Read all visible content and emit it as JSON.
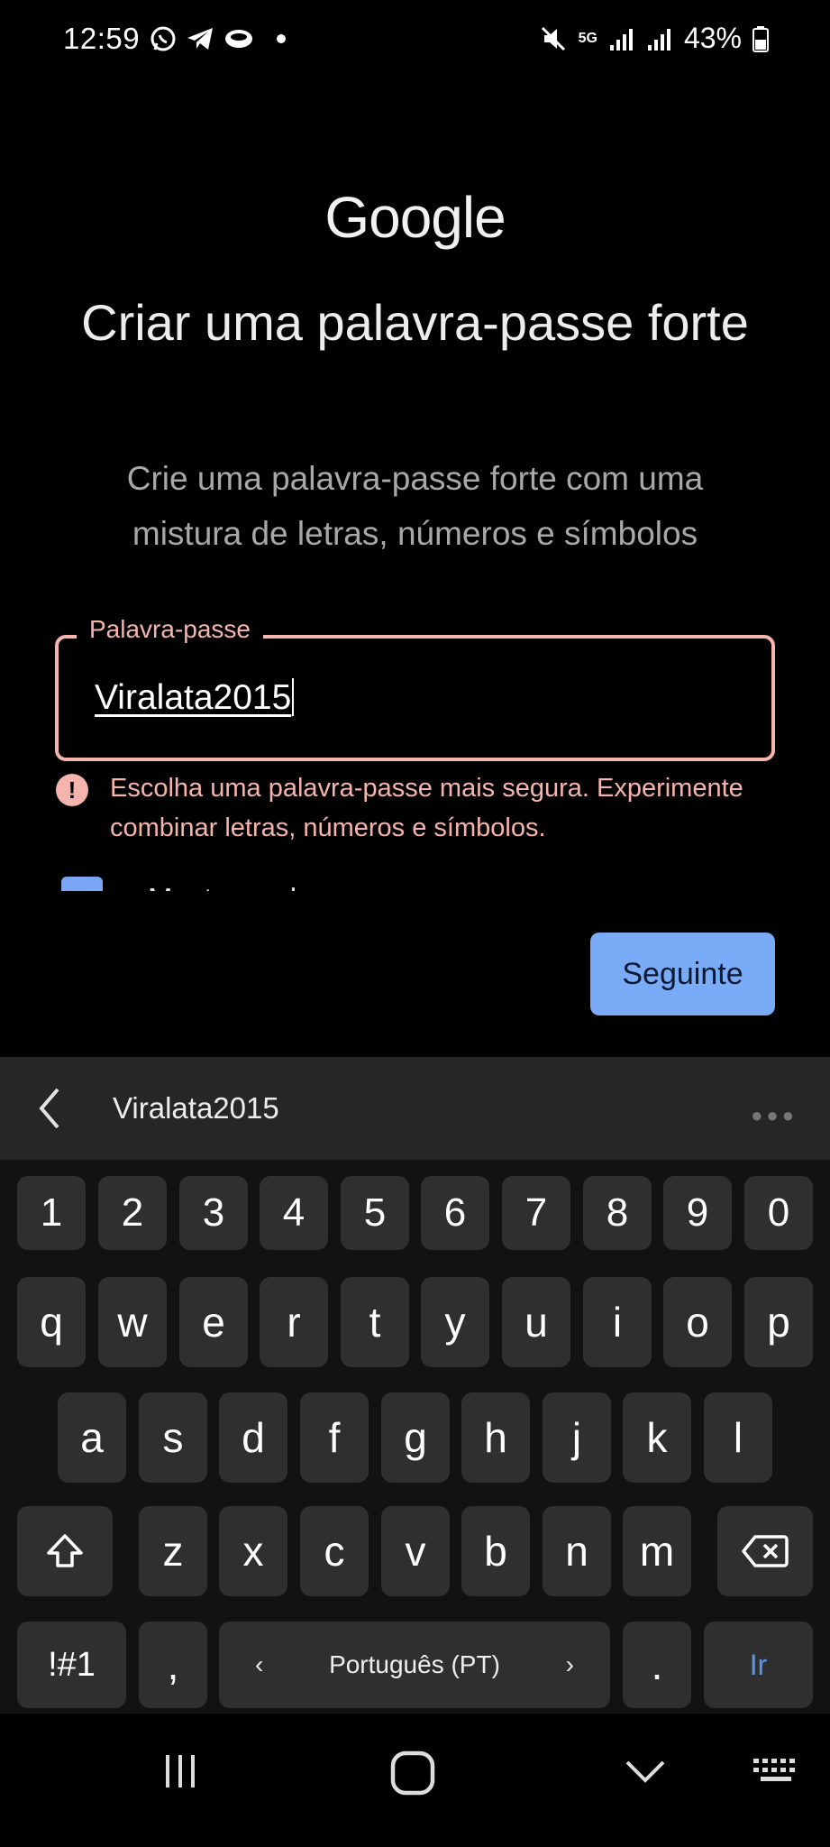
{
  "status_bar": {
    "time": "12:59",
    "left_icons": [
      "whatsapp-icon",
      "telegram-icon",
      "app-icon",
      "dot-icon"
    ],
    "network": "5G",
    "battery": "43%"
  },
  "header": {
    "logo": "Google",
    "title": "Criar uma palavra-passe forte",
    "subtitle": "Crie uma palavra-passe forte com uma mistura de letras, números e símbolos"
  },
  "password": {
    "label": "Palavra-passe",
    "value": "Viralata2015",
    "error": "Escolha uma palavra-passe mais segura. Experimente combinar letras, números e símbolos."
  },
  "show_password": {
    "label": "Mostrar palavra-passe",
    "checked": true
  },
  "next_button": "Seguinte",
  "keyboard": {
    "suggestion": "Viralata2015",
    "rows": {
      "numbers": [
        "1",
        "2",
        "3",
        "4",
        "5",
        "6",
        "7",
        "8",
        "9",
        "0"
      ],
      "row1": [
        "q",
        "w",
        "e",
        "r",
        "t",
        "y",
        "u",
        "i",
        "o",
        "p"
      ],
      "row2": [
        "a",
        "s",
        "d",
        "f",
        "g",
        "h",
        "j",
        "k",
        "l"
      ],
      "row3": [
        "z",
        "x",
        "c",
        "v",
        "b",
        "n",
        "m"
      ]
    },
    "symbols_key": "!#1",
    "comma_key": ",",
    "space_label": "Português (PT)",
    "period_key": ".",
    "go_key": "Ir"
  },
  "colors": {
    "accent": "#7aabf7",
    "error": "#f5b4ad",
    "background": "#000000",
    "key": "#2f2f2f"
  }
}
